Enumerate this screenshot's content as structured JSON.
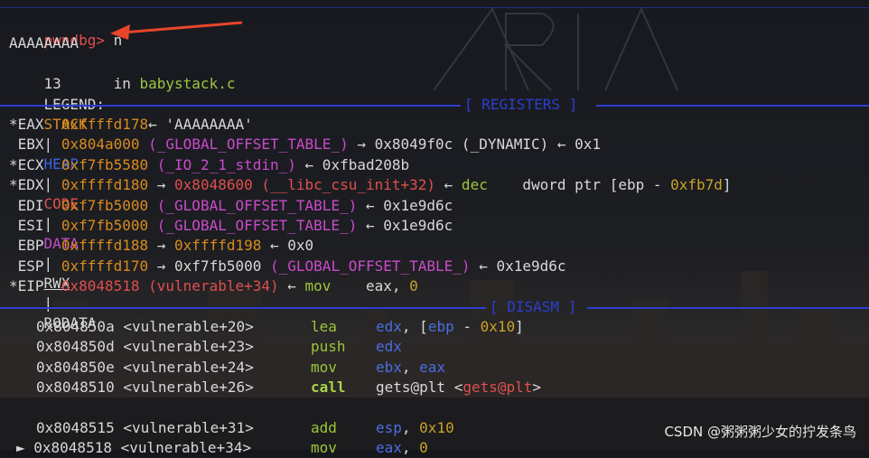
{
  "prompt": {
    "name": "pwndbg>",
    "command": "n"
  },
  "output": {
    "input_echo": "AAAAAAAA",
    "line_no": "13",
    "line_in": "in",
    "line_file": "babystack.c"
  },
  "legend": {
    "label": "LEGEND:",
    "stack": "STACK",
    "heap": "HEAP",
    "code": "CODE",
    "data": "DATA",
    "rwx": "RWX",
    "rodata": "RODATA",
    "sep": "|"
  },
  "sections": {
    "registers": "[ REGISTERS ]",
    "disasm": "[ DISASM ]"
  },
  "registers": [
    {
      "mark": "*",
      "name": "EAX",
      "val": "0xffffd178",
      "rest": [
        [
          "arrow",
          "←"
        ],
        [
          "plain",
          " 'AAAAAAAA'"
        ]
      ]
    },
    {
      "mark": " ",
      "name": "EBX",
      "val": "0x804a000",
      "rest": [
        [
          "mag",
          " (_GLOBAL_OFFSET_TABLE_)"
        ],
        [
          "arrow",
          " →"
        ],
        [
          "plain",
          " 0x8049f0c (_DYNAMIC)"
        ],
        [
          "arrow",
          " ←"
        ],
        [
          "plain",
          " 0x1"
        ]
      ]
    },
    {
      "mark": "*",
      "name": "ECX",
      "val": "0xf7fb5580",
      "rest": [
        [
          "mag",
          " (_IO_2_1_stdin_)"
        ],
        [
          "arrow",
          " ←"
        ],
        [
          "plain",
          " 0xfbad208b"
        ]
      ]
    },
    {
      "mark": "*",
      "name": "EDX",
      "val": "0xffffd180",
      "rest": [
        [
          "arrow",
          " →"
        ],
        [
          "red",
          " 0x8048600 (__libc_csu_init+32)"
        ],
        [
          "arrow",
          " ←"
        ],
        [
          "green",
          " dec"
        ],
        [
          "plain",
          "    dword ptr [ebp - "
        ],
        [
          "gold",
          "0xfb7d"
        ],
        [
          "plain",
          "]"
        ]
      ]
    },
    {
      "mark": " ",
      "name": "EDI",
      "val": "0xf7fb5000",
      "rest": [
        [
          "mag",
          " (_GLOBAL_OFFSET_TABLE_)"
        ],
        [
          "arrow",
          " ←"
        ],
        [
          "plain",
          " 0x1e9d6c"
        ]
      ]
    },
    {
      "mark": " ",
      "name": "ESI",
      "val": "0xf7fb5000",
      "rest": [
        [
          "mag",
          " (_GLOBAL_OFFSET_TABLE_)"
        ],
        [
          "arrow",
          " ←"
        ],
        [
          "plain",
          " 0x1e9d6c"
        ]
      ]
    },
    {
      "mark": " ",
      "name": "EBP",
      "val": "0xffffd188",
      "rest": [
        [
          "arrow",
          " →"
        ],
        [
          "orange",
          " 0xffffd198"
        ],
        [
          "arrow",
          " ←"
        ],
        [
          "plain",
          " 0x0"
        ]
      ]
    },
    {
      "mark": " ",
      "name": "ESP",
      "val": "0xffffd170",
      "rest": [
        [
          "arrow",
          " →"
        ],
        [
          "plain",
          " 0xf7fb5000"
        ],
        [
          "mag",
          " (_GLOBAL_OFFSET_TABLE_)"
        ],
        [
          "arrow",
          " ←"
        ],
        [
          "plain",
          " 0x1e9d6c"
        ]
      ]
    },
    {
      "mark": "*",
      "name": "EIP",
      "val": "0x8048518 (vulnerable+34)",
      "valcolor": "red",
      "rest": [
        [
          "arrow",
          " ←"
        ],
        [
          "green",
          " mov"
        ],
        [
          "plain",
          "    eax, "
        ],
        [
          "gold",
          "0"
        ]
      ]
    }
  ],
  "disasm": [
    {
      "addr": "0x804850a <vulnerable+20>",
      "op": "lea",
      "args": [
        [
          "blue",
          "edx"
        ],
        [
          "plain",
          ", ["
        ],
        [
          "blue",
          "ebp"
        ],
        [
          "plain",
          " - "
        ],
        [
          "gold",
          "0x10"
        ],
        [
          "plain",
          "]"
        ]
      ]
    },
    {
      "addr": "0x804850d <vulnerable+23>",
      "op": "push",
      "args": [
        [
          "blue",
          "edx"
        ]
      ]
    },
    {
      "addr": "0x804850e <vulnerable+24>",
      "op": "mov",
      "args": [
        [
          "blue",
          "ebx"
        ],
        [
          "plain",
          ", "
        ],
        [
          "blue",
          "eax"
        ]
      ]
    },
    {
      "addr": "0x8048510 <vulnerable+26>",
      "op": "call",
      "opbold": true,
      "args": [
        [
          "plain",
          "gets@plt <"
        ],
        [
          "red",
          "gets@plt"
        ],
        [
          "plain",
          ">"
        ]
      ]
    },
    {
      "addr": "",
      "op": "",
      "args": []
    },
    {
      "addr": "0x8048515 <vulnerable+31>",
      "op": "add",
      "args": [
        [
          "blue",
          "esp"
        ],
        [
          "plain",
          ", "
        ],
        [
          "gold",
          "0x10"
        ]
      ]
    },
    {
      "addr": "► 0x8048518 <vulnerable+34>",
      "op": "mov",
      "args": [
        [
          "blue",
          "eax"
        ],
        [
          "plain",
          ", "
        ],
        [
          "gold",
          "0"
        ]
      ]
    }
  ],
  "watermark": "CSDN @粥粥粥少女的拧发条鸟",
  "colors": {
    "arrow": "#e8452c",
    "prompt": "#e04f4f",
    "separator": "#2a3fd0"
  }
}
